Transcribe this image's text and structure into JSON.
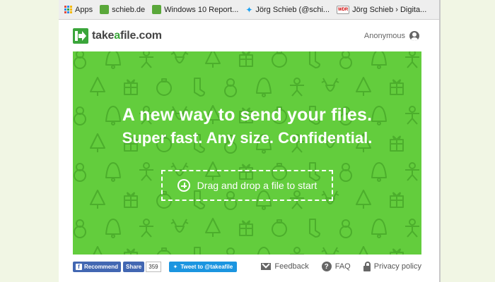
{
  "bookmarks": [
    {
      "label": "Apps",
      "icon": "apps-grid-icon"
    },
    {
      "label": "schieb.de",
      "icon": "site-favicon"
    },
    {
      "label": "Windows 10 Report...",
      "icon": "site-favicon"
    },
    {
      "label": "Jörg Schieb (@schi...",
      "icon": "twitter-bird-icon"
    },
    {
      "label": "Jörg Schieb › Digita...",
      "icon": "wdr-logo-icon"
    }
  ],
  "header": {
    "logo_pre": "take",
    "logo_accent": "a",
    "logo_post": "file.com",
    "user_label": "Anonymous"
  },
  "hero": {
    "headline": "A new way to send your files.",
    "subline": "Super fast. Any size. Confidential.",
    "dropzone_label": "Drag and drop a file to start",
    "bg_color": "#63cd3d"
  },
  "footer": {
    "fb_recommend": "Recommend",
    "fb_share": "Share",
    "share_count": "359",
    "tweet": "Tweet to @takeafile",
    "links": {
      "feedback": "Feedback",
      "faq": "FAQ",
      "privacy": "Privacy policy"
    }
  },
  "colors": {
    "brand_green": "#3aa53a",
    "facebook_blue": "#4267b2",
    "twitter_blue": "#1b95e0"
  }
}
